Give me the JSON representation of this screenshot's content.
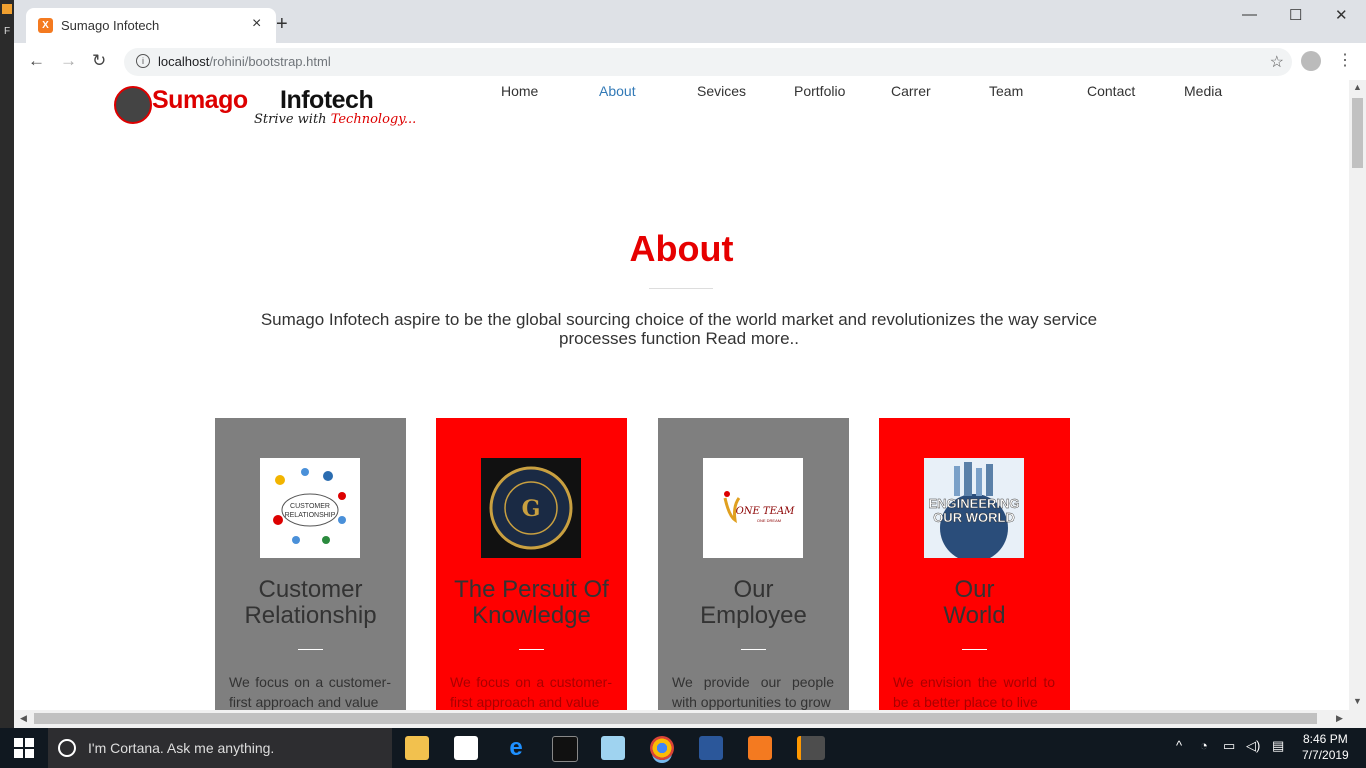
{
  "browser": {
    "tab_title": "Sumago Infotech",
    "tab_close": "×",
    "new_tab": "+",
    "url_host": "localhost",
    "url_path": "/rohini/bootstrap.html",
    "window_minimize": "—",
    "window_maximize": "☐",
    "window_close": "✕"
  },
  "site": {
    "logo": {
      "name1": "Sumago",
      "name2": "Infotech",
      "tag1": "Strive with",
      "tag2": "Technology..."
    },
    "nav": [
      "Home",
      "About",
      "Sevices",
      "Portfolio",
      "Carrer",
      "Team",
      "Contact",
      "Media"
    ],
    "active_nav": "About",
    "section_title": "About",
    "lead_line1": "Sumago Infotech aspire to be the global sourcing choice of the world market and revolutionizes the way service",
    "lead_line2": "processes function Read more..",
    "cards": [
      {
        "title1": "Customer",
        "title2": "Relationship",
        "text": "We focus on a customer-first approach and value",
        "image": "customer-relationship-image",
        "color": "#7f7f7f"
      },
      {
        "title1": "The Persuit Of",
        "title2": "Knowledge",
        "text": "We focus on a customer-first approach and value",
        "image": "pursuit-of-knowledge-image",
        "color": "#ff0000"
      },
      {
        "title1": "Our",
        "title2": "Employee",
        "text": "We provide our people with opportunities to grow",
        "image": "one-team-image",
        "color": "#7f7f7f"
      },
      {
        "title1": "Our",
        "title2": "World",
        "text": "We envision the world to be a better place to live",
        "image": "engineering-our-world-image",
        "color": "#ff0000"
      }
    ]
  },
  "taskbar": {
    "search_placeholder": "I'm Cortana. Ask me anything.",
    "time": "8:46 PM",
    "date": "7/7/2019"
  }
}
